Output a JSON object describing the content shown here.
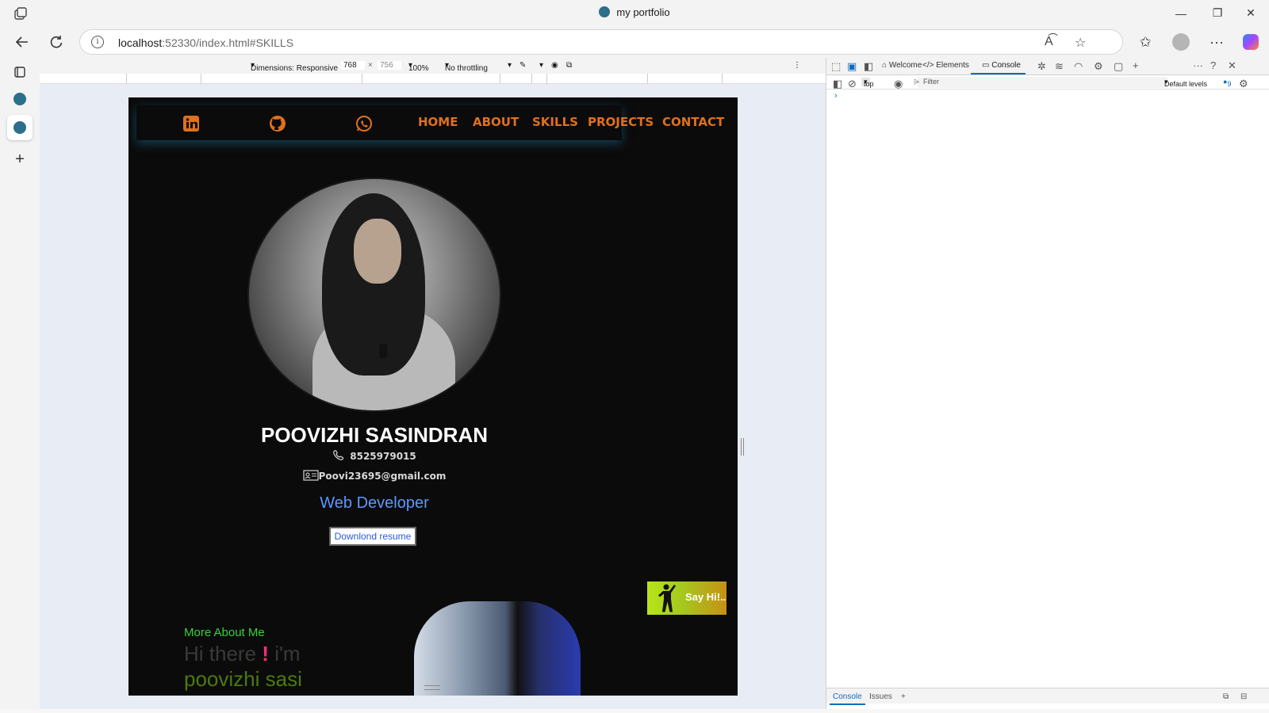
{
  "window": {
    "title": "my portfolio",
    "minimize": "—",
    "restore": "❐",
    "close": "✕"
  },
  "address_bar": {
    "host": "localhost",
    "rest": ":52330/index.html#SKILLS"
  },
  "device_toolbar": {
    "dimensions_label": "Dimensions: Responsive",
    "width": "768",
    "times": "×",
    "height": "756",
    "zoom": "100%",
    "throttling": "No throttling"
  },
  "site": {
    "nav": [
      "HOME",
      "ABOUT",
      "SKILLS",
      "PROJECTS",
      "CONTACT"
    ],
    "name": "POOVIZHI SASINDRAN",
    "phone": "8525979015",
    "email": "Poovi23695@gmail.com",
    "role": "Web Developer",
    "resume_button": "Downlond resume",
    "say_hi": "Say Hi!..",
    "more_about": "More About Me",
    "hi_there": "Hi there",
    "excl": "!",
    "im": "i'm",
    "hi_name": "poovizhi sasi",
    "colors": {
      "accent_orange": "#e0701e",
      "role_blue": "#5c98ff",
      "green": "#38d03a",
      "pink": "#ff2d78"
    }
  },
  "devtools": {
    "tabs": [
      "Welcome",
      "Elements",
      "Console"
    ],
    "active_tab": "Console",
    "context": "top",
    "filter_placeholder": "Filter",
    "levels": "Default levels",
    "issues_count": "9",
    "prompt": "›",
    "bottom_tabs": [
      "Console",
      "Issues"
    ]
  },
  "icons": [
    "linkedin-icon",
    "github-icon",
    "whatsapp-icon",
    "phone-icon",
    "contact-card-icon",
    "person-waving-icon"
  ]
}
